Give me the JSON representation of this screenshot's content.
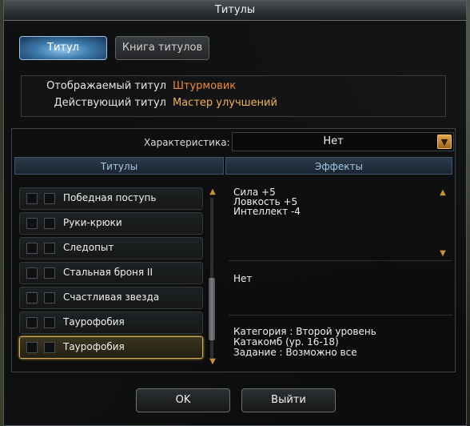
{
  "window": {
    "title": "Титулы"
  },
  "tabs": [
    {
      "label": "Титул",
      "active": true
    },
    {
      "label": "Книга титулов",
      "active": false
    }
  ],
  "info": {
    "display_label": "Отображаемый титул",
    "display_value": "Штурмовик",
    "active_label": "Действующий титул",
    "active_value": "Мастер улучшений"
  },
  "filter": {
    "label": "Характеристика:",
    "value": "Нет"
  },
  "columns": {
    "titles": "Титулы",
    "effects": "Эффекты"
  },
  "titles_list": [
    {
      "label": "Победная поступь"
    },
    {
      "label": "Руки-крюки"
    },
    {
      "label": "Следопыт"
    },
    {
      "label": "Стальная броня II"
    },
    {
      "label": "Счастливая звезда"
    },
    {
      "label": "Таурофобия"
    },
    {
      "label": "Таурофобия",
      "selected": true
    }
  ],
  "effects": {
    "stats": [
      "Сила +5",
      "Ловкость +5",
      "Интеллект -4"
    ],
    "note": "Нет",
    "description": [
      "Категория : Второй уровень",
      "Катакомб (ур. 16-18)",
      "Задание : Возможно все"
    ]
  },
  "buttons": {
    "ok": "OK",
    "exit": "Выйти"
  },
  "colors": {
    "accent_orange": "#f08a3a",
    "gold_border": "#d6b253",
    "tab_blue": "#3d79ab"
  }
}
